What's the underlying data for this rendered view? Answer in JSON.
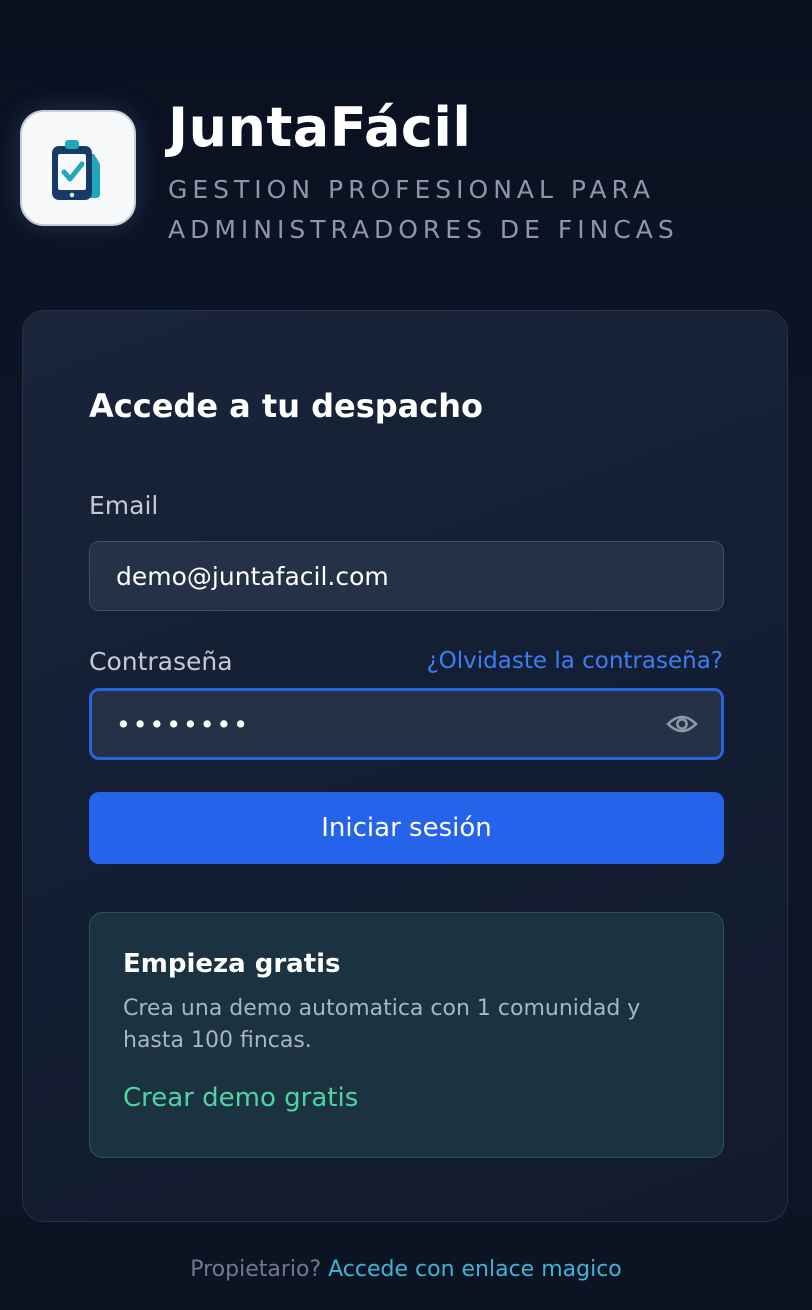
{
  "app": {
    "name": "JuntaFácil",
    "tagline": "GESTION PROFESIONAL PARA ADMINISTRADORES DE FINCAS",
    "logo_icon": "clipboard-check-icon"
  },
  "login": {
    "title": "Accede a tu despacho",
    "email_label": "Email",
    "email_value": "demo@juntafacil.com",
    "password_label": "Contraseña",
    "password_value": "password",
    "forgot_password": "¿Olvidaste la contraseña?",
    "show_password_icon": "eye-icon",
    "submit_label": "Iniciar sesión"
  },
  "demo": {
    "title": "Empieza gratis",
    "description": "Crea una demo automatica con 1 comunidad y hasta 100 fincas.",
    "link": "Crear demo gratis"
  },
  "footer": {
    "text": "Propietario?",
    "link": "Accede con enlace magico"
  },
  "colors": {
    "primary": "#2563eb",
    "link": "#3b7ef4",
    "accent_green": "#4fd3a2",
    "footer_link": "#3fb3d6",
    "background": "#0b1222",
    "card": "#172136"
  }
}
